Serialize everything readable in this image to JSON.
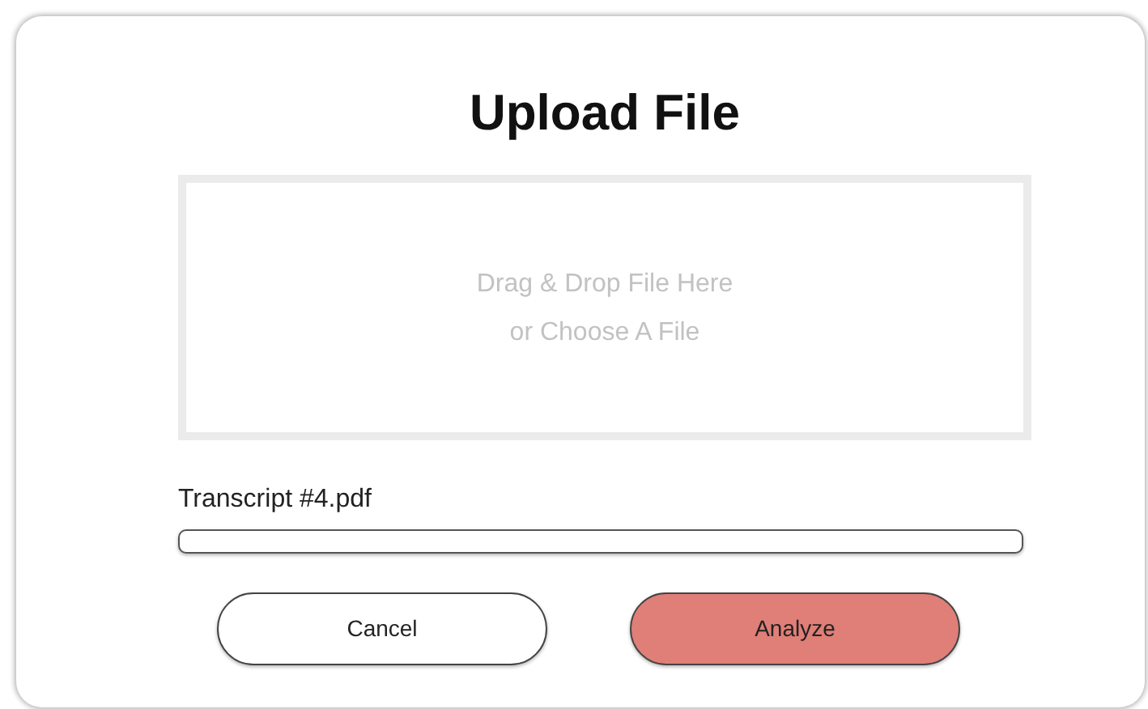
{
  "title": "Upload File",
  "drop_zone": {
    "lines": [
      "Drag & Drop File Here",
      "or Choose A File"
    ]
  },
  "file": {
    "name": "Transcript #4.pdf",
    "level": 0
  },
  "buttons": [
    {
      "label": "Cancel",
      "kind": "secondary"
    },
    {
      "label": "Analyze",
      "kind": "primary"
    }
  ]
}
